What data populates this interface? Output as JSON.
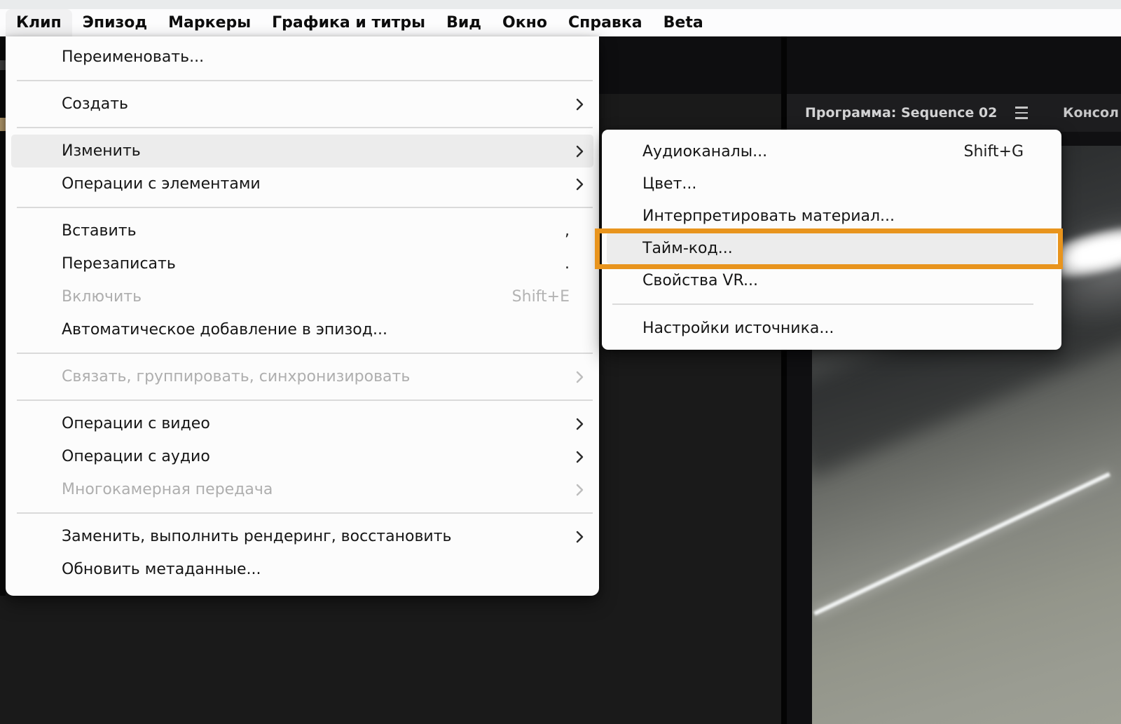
{
  "menubar": {
    "items": [
      {
        "id": "clip",
        "label": "Клип",
        "active": true
      },
      {
        "id": "sequence",
        "label": "Эпизод"
      },
      {
        "id": "markers",
        "label": "Маркеры"
      },
      {
        "id": "graphics-titles",
        "label": "Графика и титры"
      },
      {
        "id": "view",
        "label": "Вид"
      },
      {
        "id": "window",
        "label": "Окно"
      },
      {
        "id": "help",
        "label": "Справка"
      },
      {
        "id": "beta",
        "label": "Beta"
      }
    ]
  },
  "clip_menu": {
    "items": [
      {
        "id": "rename",
        "label": "Переименовать..."
      },
      {
        "type": "separator"
      },
      {
        "id": "create",
        "label": "Создать",
        "submenu": true
      },
      {
        "type": "separator"
      },
      {
        "id": "modify",
        "label": "Изменить",
        "submenu": true,
        "highlighted": true
      },
      {
        "id": "item-operations",
        "label": "Операции с элементами",
        "submenu": true
      },
      {
        "type": "separator"
      },
      {
        "id": "insert",
        "label": "Вставить",
        "shortcut": ","
      },
      {
        "id": "overwrite",
        "label": "Перезаписать",
        "shortcut": "."
      },
      {
        "id": "enable",
        "label": "Включить",
        "shortcut": "Shift+E",
        "disabled": true
      },
      {
        "id": "auto-add-to-sequence",
        "label": "Автоматическое добавление в эпизод..."
      },
      {
        "type": "separator"
      },
      {
        "id": "link-group-sync",
        "label": "Связать, группировать, синхронизировать",
        "submenu": true,
        "disabled": true
      },
      {
        "type": "separator"
      },
      {
        "id": "video-options",
        "label": "Операции с видео",
        "submenu": true
      },
      {
        "id": "audio-options",
        "label": "Операции с аудио",
        "submenu": true
      },
      {
        "id": "multicamera",
        "label": "Многокамерная передача",
        "submenu": true,
        "disabled": true
      },
      {
        "type": "separator"
      },
      {
        "id": "replace-render-restore",
        "label": "Заменить, выполнить рендеринг, восстановить",
        "submenu": true
      },
      {
        "id": "update-metadata",
        "label": "Обновить метаданные..."
      }
    ]
  },
  "modify_submenu": {
    "items": [
      {
        "id": "audio-channels",
        "label": "Аудиоканалы...",
        "shortcut": "Shift+G"
      },
      {
        "id": "color",
        "label": "Цвет..."
      },
      {
        "id": "interpret-footage",
        "label": "Интерпретировать материал..."
      },
      {
        "id": "timecode",
        "label": "Тайм-код...",
        "highlighted": true,
        "annotated": true
      },
      {
        "id": "vr-properties",
        "label": "Свойства VR..."
      },
      {
        "type": "separator"
      },
      {
        "id": "source-settings",
        "label": "Настройки источника..."
      }
    ]
  },
  "program_panel": {
    "title": "Программа: Sequence 02",
    "console_tab_label": "Консол"
  },
  "annotation": {
    "target": "Тайм-код...",
    "color": "#E8941D"
  },
  "colors": {
    "annotation_orange": "#E8941D",
    "menu_background": "#FCFCFC",
    "menu_highlight": "#ECECEC",
    "app_dark": "#1A1A1A",
    "panel_header": "#1D1D1F"
  }
}
